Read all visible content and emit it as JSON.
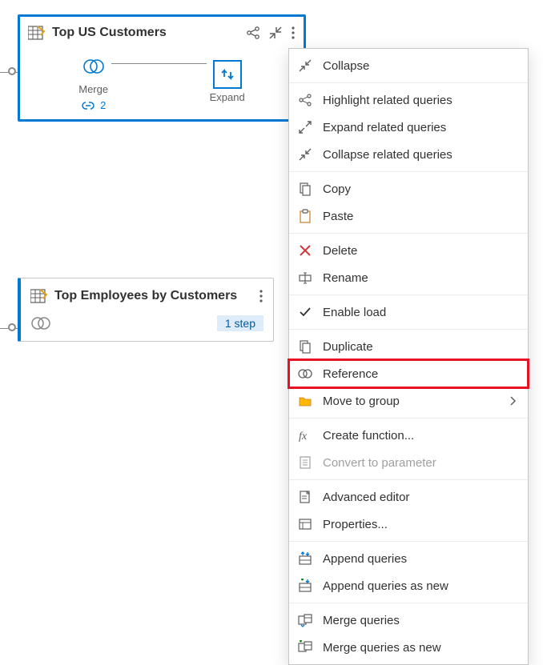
{
  "card1": {
    "title": "Top US Customers",
    "step1_label": "Merge",
    "step2_label": "Expand",
    "link_count": "2"
  },
  "card2": {
    "title": "Top Employees by Customers",
    "step_count": "1 step"
  },
  "menu": {
    "collapse": "Collapse",
    "highlight_related": "Highlight related queries",
    "expand_related": "Expand related queries",
    "collapse_related": "Collapse related queries",
    "copy": "Copy",
    "paste": "Paste",
    "delete": "Delete",
    "rename": "Rename",
    "enable_load": "Enable load",
    "duplicate": "Duplicate",
    "reference": "Reference",
    "move_to_group": "Move to group",
    "create_function": "Create function...",
    "convert_parameter": "Convert to parameter",
    "advanced_editor": "Advanced editor",
    "properties": "Properties...",
    "append_queries": "Append queries",
    "append_new": "Append queries as new",
    "merge_queries": "Merge queries",
    "merge_new": "Merge queries as new"
  }
}
